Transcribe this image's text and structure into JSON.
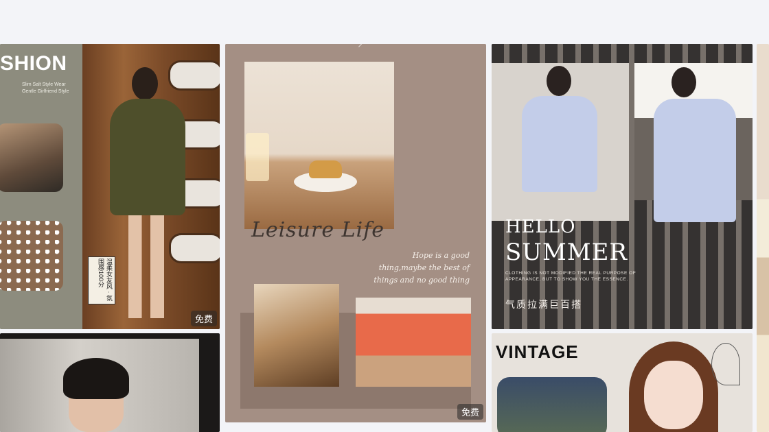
{
  "cards": [
    {
      "headline": "SHION",
      "subtitle1": "Slim Salt Style Wear",
      "subtitle2": "Gentle Girlfriend Style",
      "vertical_text": "温柔女友风 · 氛围感100分",
      "badge": "免费"
    },
    {
      "title": "Leisure Life",
      "quote": "Hope is a good thing,maybe the best of things and no good thing",
      "badge": "免费"
    },
    {
      "hello": "HELLO",
      "summer": "SUMMER",
      "small_text": "CLOTHING IS NOT MODIFIED THE REAL PURPOSE OF APPEARANCE, BUT TO SHOW YOU THE ESSENCE.",
      "chinese_text": "气质拉满巨百搭"
    },
    {
      "label": ""
    },
    {
      "label": "VINTAGE"
    }
  ],
  "colors": {
    "page_bg": "#f3f4f8",
    "badge_bg": "#555555"
  }
}
